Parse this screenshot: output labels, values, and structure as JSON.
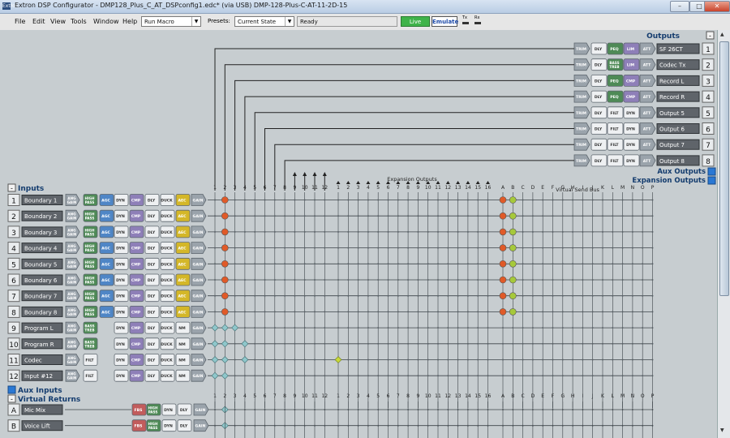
{
  "window": {
    "title": "Extron DSP Configurator - DMP128_Plus_C_AT_DSPconfig1.edc* (via USB) DMP-128-Plus-C-AT-11-2D-15",
    "app_icon": "Extron",
    "minimize_icon": "minimize-icon",
    "maximize_icon": "maximize-icon",
    "close_icon": "close-icon"
  },
  "menubar": {
    "items": [
      "File",
      "Edit",
      "View",
      "Tools",
      "Window",
      "Help"
    ],
    "macro_select": "Run Macro",
    "presets_label": "Presets:",
    "presets_select": "Current State",
    "status": "Ready",
    "live_label": "Live",
    "emulate_label": "Emulate",
    "tx_label": "Tx",
    "rx_label": "Rx"
  },
  "colors": {
    "live": "#3fb34a",
    "emulate": "#ffffff",
    "gain_block": "#9aa3ab",
    "hpf_block": "#4e8a56",
    "agc_block": "#4f86c6",
    "dyn_block": "#e3e6ea",
    "duck_block": "#e3e6ea",
    "aec_block": "#d4b728",
    "lim_block": "#8e7fb8",
    "peq_block": "#4e8a56",
    "fbs_block": "#c25c5c",
    "node_red": "#e05a28",
    "node_green": "#a6c93a",
    "node_teal": "#8fc7cb"
  },
  "outputs": {
    "heading": "Outputs",
    "collapse_icon": "collapse-minus-icon",
    "items": [
      {
        "num": "1",
        "name": "SF 26CT",
        "blocks": [
          "TRIM",
          "DLY",
          "PEQ",
          "LIM",
          "ATT"
        ]
      },
      {
        "num": "2",
        "name": "Codec Tx",
        "blocks": [
          "TRIM",
          "DLY",
          "BASS TREB",
          "LIM",
          "ATT"
        ]
      },
      {
        "num": "3",
        "name": "Record L",
        "blocks": [
          "TRIM",
          "DLY",
          "PEQ",
          "CMP",
          "ATT"
        ]
      },
      {
        "num": "4",
        "name": "Record R",
        "blocks": [
          "TRIM",
          "DLY",
          "PEQ",
          "CMP",
          "ATT"
        ]
      },
      {
        "num": "5",
        "name": "Output 5",
        "blocks": [
          "TRIM",
          "DLY",
          "FILT",
          "DYN",
          "ATT"
        ]
      },
      {
        "num": "6",
        "name": "Output 6",
        "blocks": [
          "TRIM",
          "DLY",
          "FILT",
          "DYN",
          "ATT"
        ]
      },
      {
        "num": "7",
        "name": "Output 7",
        "blocks": [
          "TRIM",
          "DLY",
          "FILT",
          "DYN",
          "ATT"
        ]
      },
      {
        "num": "8",
        "name": "Output 8",
        "blocks": [
          "TRIM",
          "DLY",
          "FILT",
          "DYN",
          "ATT"
        ]
      }
    ],
    "aux_outputs_label": "Aux Outputs",
    "expansion_outputs_label": "Expansion Outputs"
  },
  "matrix": {
    "output_columns": [
      "1",
      "2",
      "3",
      "4",
      "5",
      "6",
      "7",
      "8",
      "9",
      "10",
      "11",
      "12"
    ],
    "expansion_heading": "Expansion Outputs",
    "expansion_columns": [
      "1",
      "2",
      "3",
      "4",
      "5",
      "6",
      "7",
      "8",
      "9",
      "10",
      "11",
      "12",
      "13",
      "14",
      "15",
      "16"
    ],
    "virtual_heading": "Virtual Send Bus",
    "virtual_columns": [
      "A",
      "B",
      "C",
      "D",
      "E",
      "F",
      "G",
      "H",
      "I",
      "J",
      "K",
      "L",
      "M",
      "N",
      "O",
      "P"
    ]
  },
  "inputs": {
    "heading": "Inputs",
    "collapse_icon": "collapse-minus-icon",
    "items": [
      {
        "num": "1",
        "name": "Boundary 1",
        "blocks": [
          "ANG GAIN",
          "HIGH PASS",
          "AGC",
          "DYN",
          "CMP",
          "DLY",
          "DUCK",
          "AEC",
          "GAIN"
        ]
      },
      {
        "num": "2",
        "name": "Boundary 2",
        "blocks": [
          "ANG GAIN",
          "HIGH PASS",
          "AGC",
          "DYN",
          "CMP",
          "DLY",
          "DUCK",
          "AEC",
          "GAIN"
        ]
      },
      {
        "num": "3",
        "name": "Boundary 3",
        "blocks": [
          "ANG GAIN",
          "HIGH PASS",
          "AGC",
          "DYN",
          "CMP",
          "DLY",
          "DUCK",
          "AEC",
          "GAIN"
        ]
      },
      {
        "num": "4",
        "name": "Boundary 4",
        "blocks": [
          "ANG GAIN",
          "HIGH PASS",
          "AGC",
          "DYN",
          "CMP",
          "DLY",
          "DUCK",
          "AEC",
          "GAIN"
        ]
      },
      {
        "num": "5",
        "name": "Boundary 5",
        "blocks": [
          "ANG GAIN",
          "HIGH PASS",
          "AGC",
          "DYN",
          "CMP",
          "DLY",
          "DUCK",
          "AEC",
          "GAIN"
        ]
      },
      {
        "num": "6",
        "name": "Boundary 6",
        "blocks": [
          "ANG GAIN",
          "HIGH PASS",
          "AGC",
          "DYN",
          "CMP",
          "DLY",
          "DUCK",
          "AEC",
          "GAIN"
        ]
      },
      {
        "num": "7",
        "name": "Boundary 7",
        "blocks": [
          "ANG GAIN",
          "HIGH PASS",
          "AGC",
          "DYN",
          "CMP",
          "DLY",
          "DUCK",
          "AEC",
          "GAIN"
        ]
      },
      {
        "num": "8",
        "name": "Boundary 8",
        "blocks": [
          "ANG GAIN",
          "HIGH PASS",
          "AGC",
          "DYN",
          "CMP",
          "DLY",
          "DUCK",
          "AEC",
          "GAIN"
        ]
      },
      {
        "num": "9",
        "name": "Program L",
        "blocks": [
          "ANG GAIN",
          "BASS TREB",
          "",
          "DYN",
          "CMP",
          "DLY",
          "DUCK",
          "NM",
          "GAIN"
        ]
      },
      {
        "num": "10",
        "name": "Program R",
        "blocks": [
          "ANG GAIN",
          "BASS TREB",
          "",
          "DYN",
          "CMP",
          "DLY",
          "DUCK",
          "NM",
          "GAIN"
        ]
      },
      {
        "num": "11",
        "name": "Codec",
        "blocks": [
          "ANG GAIN",
          "FILT",
          "",
          "DYN",
          "CMP",
          "DLY",
          "DUCK",
          "NM",
          "GAIN"
        ]
      },
      {
        "num": "12",
        "name": "Input #12",
        "blocks": [
          "ANG GAIN",
          "FILT",
          "",
          "DYN",
          "CMP",
          "DLY",
          "DUCK",
          "NM",
          "GAIN"
        ]
      }
    ],
    "aux_inputs_label": "Aux Inputs",
    "virtual_returns_label": "Virtual Returns",
    "virtual_returns": [
      {
        "num": "A",
        "name": "Mic Mix",
        "blocks": [
          "FBS",
          "HIGH PASS",
          "DYN",
          "DLY",
          "GAIN"
        ]
      },
      {
        "num": "B",
        "name": "Voice Lift",
        "blocks": [
          "FBS",
          "HIGH PASS",
          "DYN",
          "DLY",
          "GAIN"
        ]
      }
    ]
  }
}
